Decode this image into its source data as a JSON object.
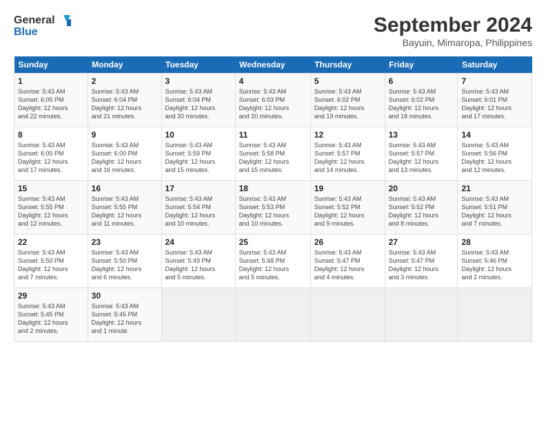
{
  "header": {
    "logo_line1": "General",
    "logo_line2": "Blue",
    "month_title": "September 2024",
    "subtitle": "Bayuin, Mimaropa, Philippines"
  },
  "columns": [
    "Sunday",
    "Monday",
    "Tuesday",
    "Wednesday",
    "Thursday",
    "Friday",
    "Saturday"
  ],
  "weeks": [
    [
      {
        "day": "1",
        "lines": [
          "Sunrise: 5:43 AM",
          "Sunset: 6:05 PM",
          "Daylight: 12 hours",
          "and 22 minutes."
        ]
      },
      {
        "day": "2",
        "lines": [
          "Sunrise: 5:43 AM",
          "Sunset: 6:04 PM",
          "Daylight: 12 hours",
          "and 21 minutes."
        ]
      },
      {
        "day": "3",
        "lines": [
          "Sunrise: 5:43 AM",
          "Sunset: 6:04 PM",
          "Daylight: 12 hours",
          "and 20 minutes."
        ]
      },
      {
        "day": "4",
        "lines": [
          "Sunrise: 5:43 AM",
          "Sunset: 6:03 PM",
          "Daylight: 12 hours",
          "and 20 minutes."
        ]
      },
      {
        "day": "5",
        "lines": [
          "Sunrise: 5:43 AM",
          "Sunset: 6:02 PM",
          "Daylight: 12 hours",
          "and 19 minutes."
        ]
      },
      {
        "day": "6",
        "lines": [
          "Sunrise: 5:43 AM",
          "Sunset: 6:02 PM",
          "Daylight: 12 hours",
          "and 18 minutes."
        ]
      },
      {
        "day": "7",
        "lines": [
          "Sunrise: 5:43 AM",
          "Sunset: 6:01 PM",
          "Daylight: 12 hours",
          "and 17 minutes."
        ]
      }
    ],
    [
      {
        "day": "8",
        "lines": [
          "Sunrise: 5:43 AM",
          "Sunset: 6:00 PM",
          "Daylight: 12 hours",
          "and 17 minutes."
        ]
      },
      {
        "day": "9",
        "lines": [
          "Sunrise: 5:43 AM",
          "Sunset: 6:00 PM",
          "Daylight: 12 hours",
          "and 16 minutes."
        ]
      },
      {
        "day": "10",
        "lines": [
          "Sunrise: 5:43 AM",
          "Sunset: 5:59 PM",
          "Daylight: 12 hours",
          "and 15 minutes."
        ]
      },
      {
        "day": "11",
        "lines": [
          "Sunrise: 5:43 AM",
          "Sunset: 5:58 PM",
          "Daylight: 12 hours",
          "and 15 minutes."
        ]
      },
      {
        "day": "12",
        "lines": [
          "Sunrise: 5:43 AM",
          "Sunset: 5:57 PM",
          "Daylight: 12 hours",
          "and 14 minutes."
        ]
      },
      {
        "day": "13",
        "lines": [
          "Sunrise: 5:43 AM",
          "Sunset: 5:57 PM",
          "Daylight: 12 hours",
          "and 13 minutes."
        ]
      },
      {
        "day": "14",
        "lines": [
          "Sunrise: 5:43 AM",
          "Sunset: 5:56 PM",
          "Daylight: 12 hours",
          "and 12 minutes."
        ]
      }
    ],
    [
      {
        "day": "15",
        "lines": [
          "Sunrise: 5:43 AM",
          "Sunset: 5:55 PM",
          "Daylight: 12 hours",
          "and 12 minutes."
        ]
      },
      {
        "day": "16",
        "lines": [
          "Sunrise: 5:43 AM",
          "Sunset: 5:55 PM",
          "Daylight: 12 hours",
          "and 11 minutes."
        ]
      },
      {
        "day": "17",
        "lines": [
          "Sunrise: 5:43 AM",
          "Sunset: 5:54 PM",
          "Daylight: 12 hours",
          "and 10 minutes."
        ]
      },
      {
        "day": "18",
        "lines": [
          "Sunrise: 5:43 AM",
          "Sunset: 5:53 PM",
          "Daylight: 12 hours",
          "and 10 minutes."
        ]
      },
      {
        "day": "19",
        "lines": [
          "Sunrise: 5:43 AM",
          "Sunset: 5:52 PM",
          "Daylight: 12 hours",
          "and 9 minutes."
        ]
      },
      {
        "day": "20",
        "lines": [
          "Sunrise: 5:43 AM",
          "Sunset: 5:52 PM",
          "Daylight: 12 hours",
          "and 8 minutes."
        ]
      },
      {
        "day": "21",
        "lines": [
          "Sunrise: 5:43 AM",
          "Sunset: 5:51 PM",
          "Daylight: 12 hours",
          "and 7 minutes."
        ]
      }
    ],
    [
      {
        "day": "22",
        "lines": [
          "Sunrise: 5:43 AM",
          "Sunset: 5:50 PM",
          "Daylight: 12 hours",
          "and 7 minutes."
        ]
      },
      {
        "day": "23",
        "lines": [
          "Sunrise: 5:43 AM",
          "Sunset: 5:50 PM",
          "Daylight: 12 hours",
          "and 6 minutes."
        ]
      },
      {
        "day": "24",
        "lines": [
          "Sunrise: 5:43 AM",
          "Sunset: 5:49 PM",
          "Daylight: 12 hours",
          "and 5 minutes."
        ]
      },
      {
        "day": "25",
        "lines": [
          "Sunrise: 5:43 AM",
          "Sunset: 5:48 PM",
          "Daylight: 12 hours",
          "and 5 minutes."
        ]
      },
      {
        "day": "26",
        "lines": [
          "Sunrise: 5:43 AM",
          "Sunset: 5:47 PM",
          "Daylight: 12 hours",
          "and 4 minutes."
        ]
      },
      {
        "day": "27",
        "lines": [
          "Sunrise: 5:43 AM",
          "Sunset: 5:47 PM",
          "Daylight: 12 hours",
          "and 3 minutes."
        ]
      },
      {
        "day": "28",
        "lines": [
          "Sunrise: 5:43 AM",
          "Sunset: 5:46 PM",
          "Daylight: 12 hours",
          "and 2 minutes."
        ]
      }
    ],
    [
      {
        "day": "29",
        "lines": [
          "Sunrise: 5:43 AM",
          "Sunset: 5:45 PM",
          "Daylight: 12 hours",
          "and 2 minutes."
        ]
      },
      {
        "day": "30",
        "lines": [
          "Sunrise: 5:43 AM",
          "Sunset: 5:45 PM",
          "Daylight: 12 hours",
          "and 1 minute."
        ]
      },
      {
        "day": "",
        "lines": []
      },
      {
        "day": "",
        "lines": []
      },
      {
        "day": "",
        "lines": []
      },
      {
        "day": "",
        "lines": []
      },
      {
        "day": "",
        "lines": []
      }
    ]
  ]
}
